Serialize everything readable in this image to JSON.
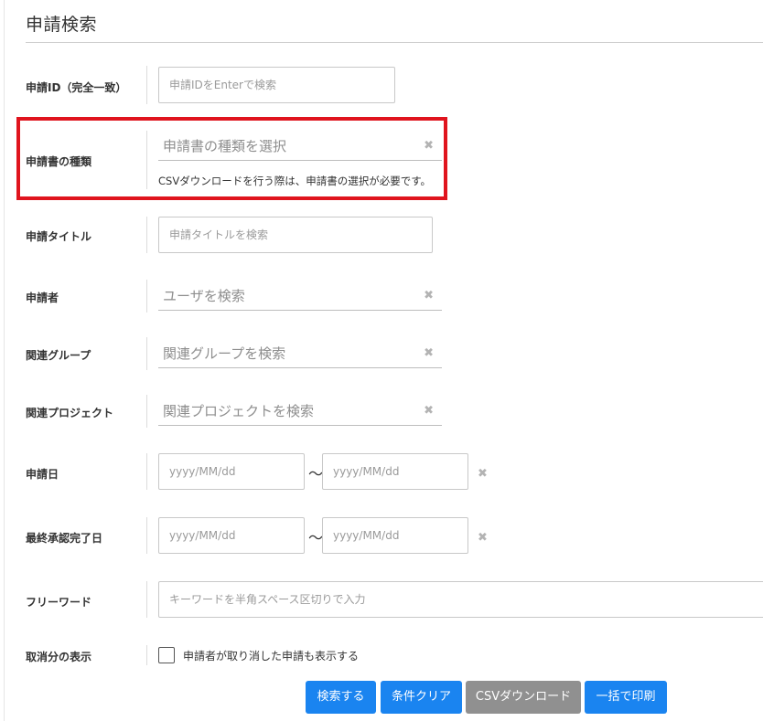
{
  "page": {
    "title": "申請検索"
  },
  "fields": {
    "application_id": {
      "label": "申請ID（完全一致）",
      "placeholder": "申請IDをEnterで検索"
    },
    "document_type": {
      "label": "申請書の種類",
      "placeholder": "申請書の種類を選択",
      "hint": "CSVダウンロードを行う際は、申請書の選択が必要です。"
    },
    "title": {
      "label": "申請タイトル",
      "placeholder": "申請タイトルを検索"
    },
    "applicant": {
      "label": "申請者",
      "placeholder": "ユーザを検索"
    },
    "group": {
      "label": "関連グループ",
      "placeholder": "関連グループを検索"
    },
    "project": {
      "label": "関連プロジェクト",
      "placeholder": "関連プロジェクトを検索"
    },
    "apply_date": {
      "label": "申請日",
      "from_placeholder": "yyyy/MM/dd",
      "to_placeholder": "yyyy/MM/dd",
      "separator": "〜"
    },
    "final_approval_date": {
      "label": "最終承認完了日",
      "from_placeholder": "yyyy/MM/dd",
      "to_placeholder": "yyyy/MM/dd",
      "separator": "〜"
    },
    "free_word": {
      "label": "フリーワード",
      "placeholder": "キーワードを半角スペース区切りで入力"
    },
    "show_cancelled": {
      "label": "取消分の表示",
      "checkbox_label": "申請者が取り消した申請も表示する",
      "checked": false
    }
  },
  "icons": {
    "clear": "✖",
    "clear_name": "clear-icon"
  },
  "buttons": {
    "search": "検索する",
    "clear": "条件クリア",
    "csv": "CSVダウンロード",
    "print": "一括で印刷"
  },
  "colors": {
    "primary": "#1a84f0",
    "disabled": "#909090",
    "highlight": "#e0141e"
  }
}
